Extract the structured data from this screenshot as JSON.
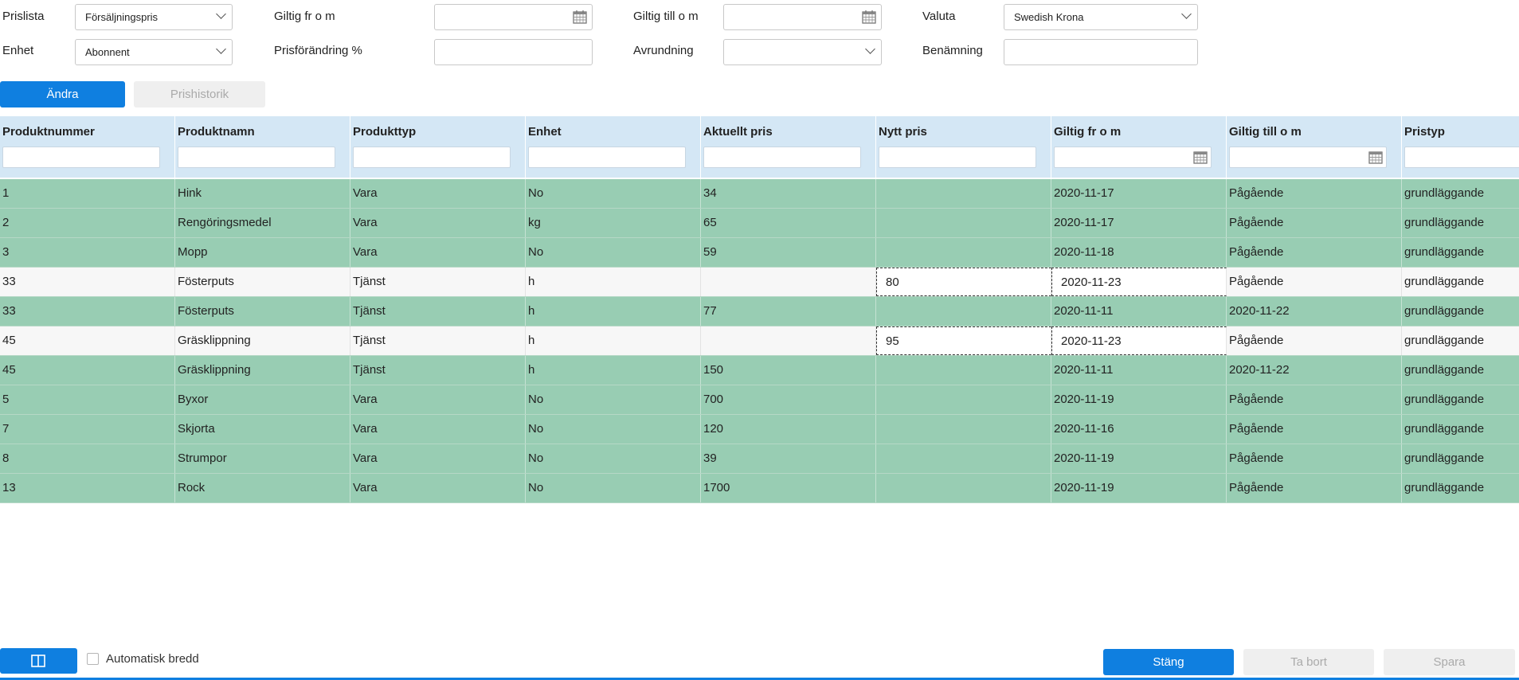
{
  "filters": {
    "prislista": {
      "label": "Prislista",
      "value": "Försäljningspris"
    },
    "enhet": {
      "label": "Enhet",
      "value": "Abonnent"
    },
    "giltig_from": {
      "label": "Giltig fr o m",
      "value": ""
    },
    "prisforandring": {
      "label": "Prisförändring %",
      "value": ""
    },
    "giltig_till": {
      "label": "Giltig till o m",
      "value": ""
    },
    "avrundning": {
      "label": "Avrundning",
      "value": ""
    },
    "valuta": {
      "label": "Valuta",
      "value": "Swedish Krona"
    },
    "benamning": {
      "label": "Benämning",
      "value": ""
    }
  },
  "actions": {
    "andra": "Ändra",
    "prishistorik": "Prishistorik"
  },
  "grid": {
    "columns": [
      "Produktnummer",
      "Produktnamn",
      "Produkttyp",
      "Enhet",
      "Aktuellt pris",
      "Nytt pris",
      "Giltig fr o m",
      "Giltig till o m",
      "Pristyp"
    ],
    "rows": [
      {
        "style": "green",
        "cells": [
          "1",
          "Hink",
          "Vara",
          "No",
          "34",
          "",
          "2020-11-17",
          "Pågående",
          "grundläggande"
        ]
      },
      {
        "style": "green",
        "cells": [
          "2",
          "Rengöringsmedel",
          "Vara",
          "kg",
          "65",
          "",
          "2020-11-17",
          "Pågående",
          "grundläggande"
        ]
      },
      {
        "style": "green",
        "cells": [
          "3",
          "Mopp",
          "Vara",
          "No",
          "59",
          "",
          "2020-11-18",
          "Pågående",
          "grundläggande"
        ]
      },
      {
        "style": "white",
        "cells": [
          "33",
          "Fösterputs",
          "Tjänst",
          "h",
          "",
          "80",
          "2020-11-23",
          "Pågående",
          "grundläggande"
        ]
      },
      {
        "style": "green",
        "cells": [
          "33",
          "Fösterputs",
          "Tjänst",
          "h",
          "77",
          "",
          "2020-11-11",
          "2020-11-22",
          "grundläggande"
        ]
      },
      {
        "style": "white",
        "cells": [
          "45",
          "Gräsklippning",
          "Tjänst",
          "h",
          "",
          "95",
          "2020-11-23",
          "Pågående",
          "grundläggande"
        ]
      },
      {
        "style": "green",
        "cells": [
          "45",
          "Gräsklippning",
          "Tjänst",
          "h",
          "150",
          "",
          "2020-11-11",
          "2020-11-22",
          "grundläggande"
        ]
      },
      {
        "style": "green",
        "cells": [
          "5",
          "Byxor",
          "Vara",
          "No",
          "700",
          "",
          "2020-11-19",
          "Pågående",
          "grundläggande"
        ]
      },
      {
        "style": "green",
        "cells": [
          "7",
          "Skjorta",
          "Vara",
          "No",
          "120",
          "",
          "2020-11-16",
          "Pågående",
          "grundläggande"
        ]
      },
      {
        "style": "green",
        "cells": [
          "8",
          "Strumpor",
          "Vara",
          "No",
          "39",
          "",
          "2020-11-19",
          "Pågående",
          "grundläggande"
        ]
      },
      {
        "style": "green",
        "cells": [
          "13",
          "Rock",
          "Vara",
          "No",
          "1700",
          "",
          "2020-11-19",
          "Pågående",
          "grundläggande"
        ]
      }
    ]
  },
  "footer": {
    "auto_width_label": "Automatisk bredd",
    "auto_width_checked": false,
    "stang": "Stäng",
    "ta_bort": "Ta bort",
    "spara": "Spara"
  },
  "colors": {
    "primary": "#0f7fe0",
    "row_green": "#98cdb3",
    "header_blue": "#d4e7f5"
  }
}
